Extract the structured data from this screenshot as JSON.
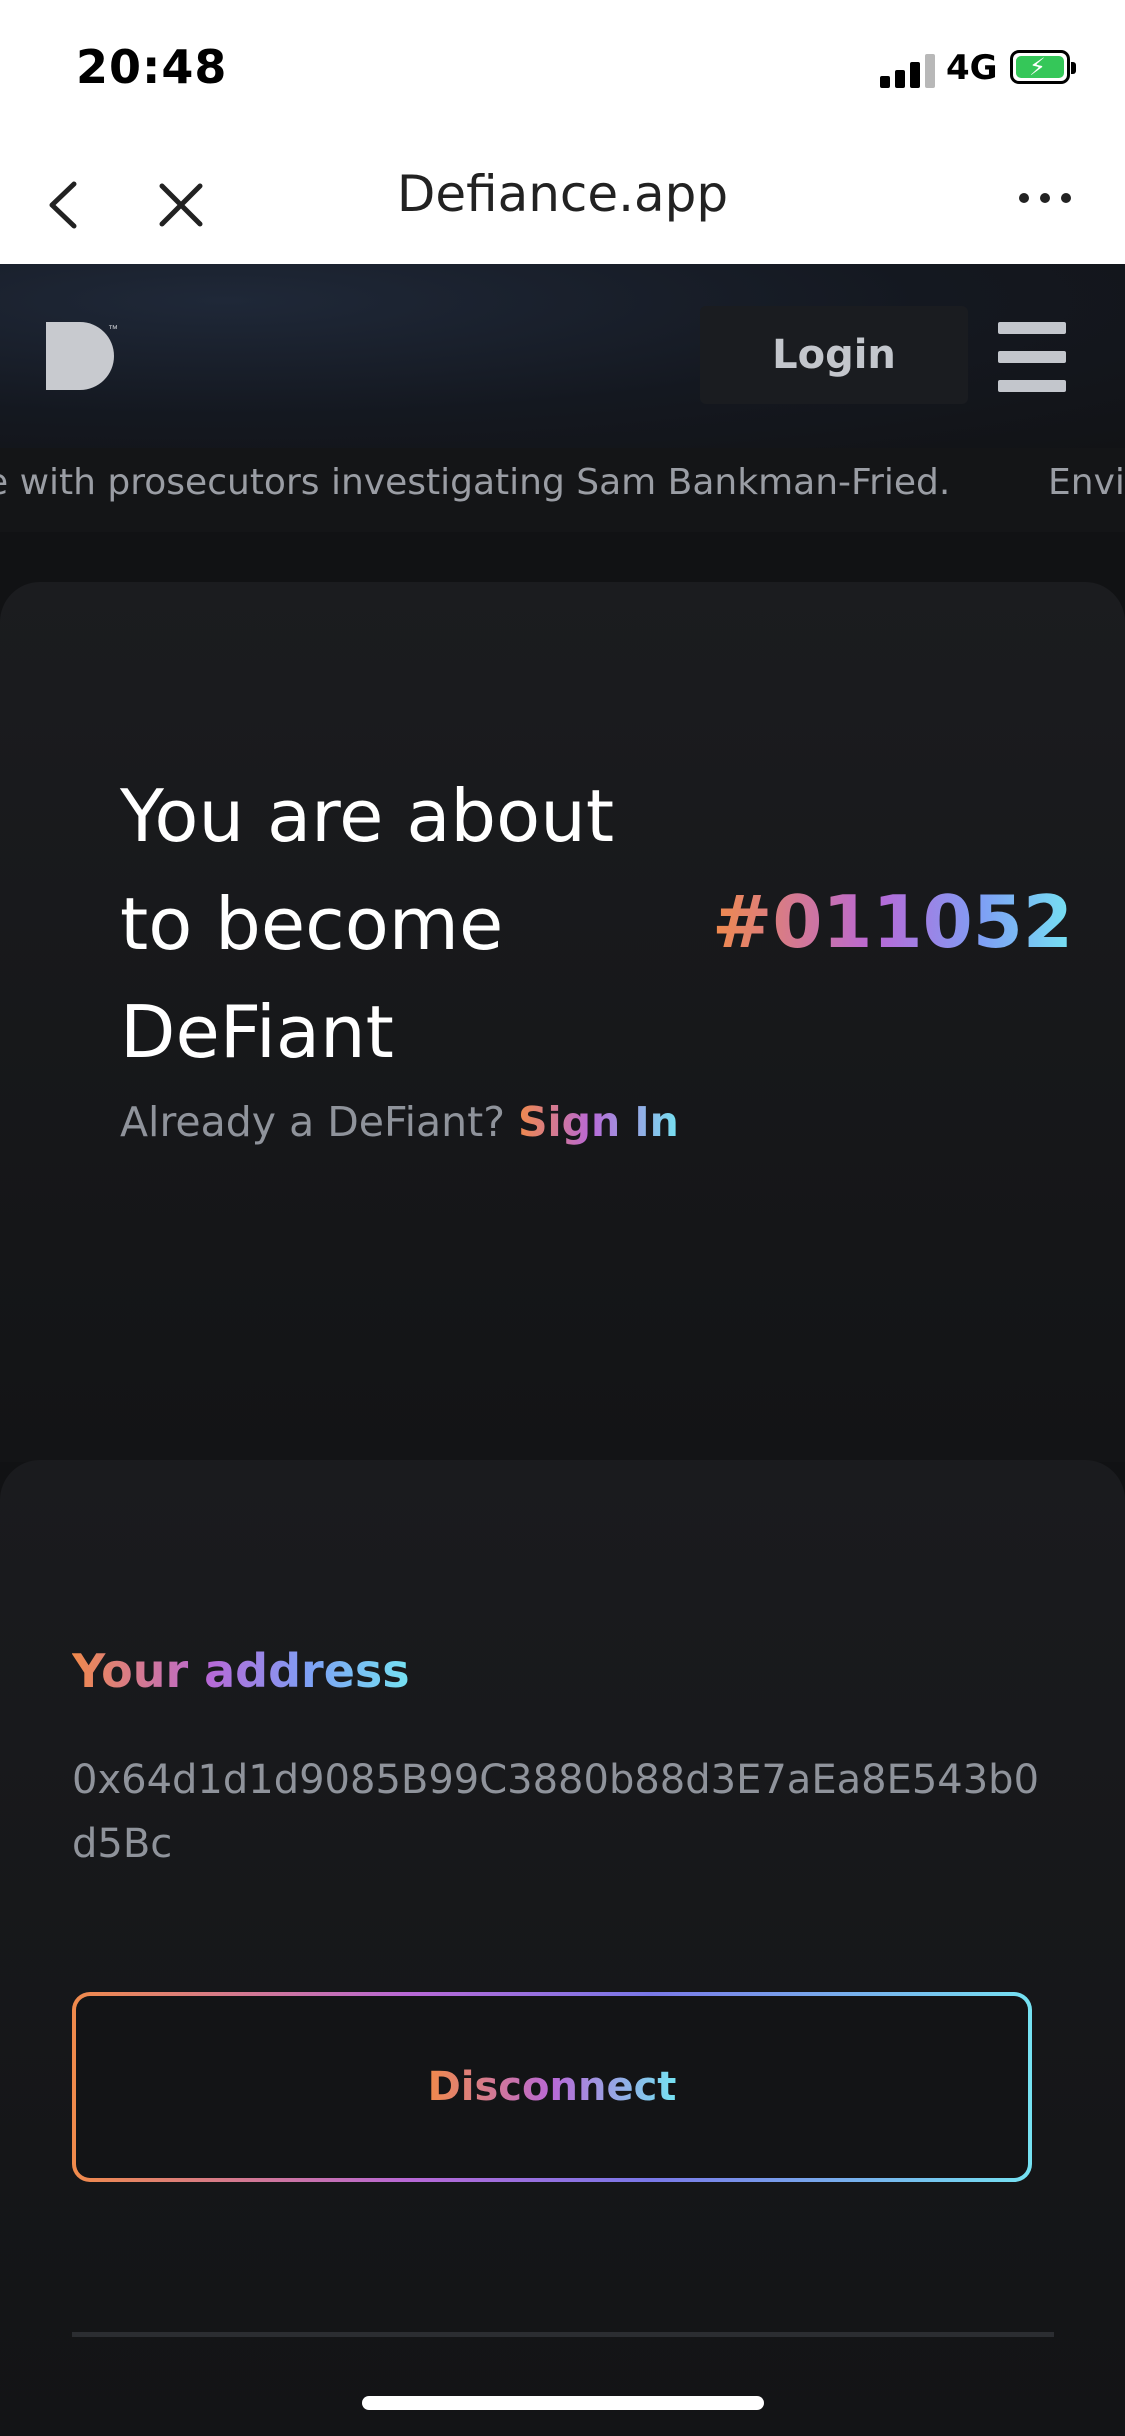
{
  "status_bar": {
    "time": "20:48",
    "network": "4G",
    "battery_charging": true
  },
  "browser": {
    "title": "Defiance.app",
    "back_icon": "chevron-left-icon",
    "close_icon": "close-icon",
    "more_icon": "more-horizontal-icon"
  },
  "header": {
    "logo_mark": "D",
    "login_label": "Login",
    "menu_icon": "hamburger-icon"
  },
  "ticker": {
    "text": "e with prosecutors investigating Sam Bankman-Fried.",
    "next_text": "Envi"
  },
  "hero": {
    "headline": "You are about to become DeFiant",
    "member_number": "#011052",
    "already_text": "Already a DeFiant?",
    "signin_label": "Sign In"
  },
  "wallet": {
    "label": "Your address",
    "address": "0x64d1d1d9085B99C3880b88d3E7aEa8E543b0d5Bc",
    "disconnect_label": "Disconnect"
  },
  "colors": {
    "gradient_start": "#f08a4b",
    "gradient_mid": "#b868d6",
    "gradient_end": "#75e2f2",
    "background": "#111214"
  }
}
